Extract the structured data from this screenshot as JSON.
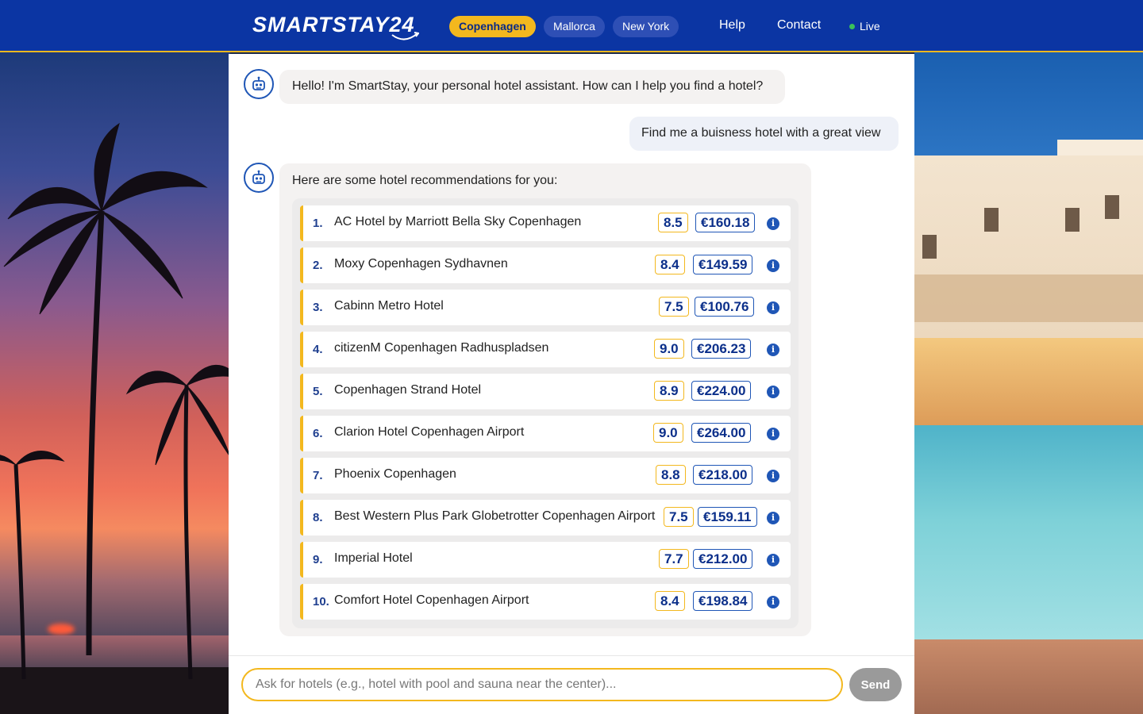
{
  "header": {
    "logo": "SMARTSTAY24",
    "cities": [
      "Copenhagen",
      "Mallorca",
      "New York"
    ],
    "active_city": "Copenhagen",
    "nav": {
      "help": "Help",
      "contact": "Contact"
    },
    "status": "Live"
  },
  "chat": {
    "greeting": "Hello! I'm SmartStay, your personal hotel assistant. How can I help you find a hotel?",
    "user_message": "Find me a buisness hotel with a great view",
    "reply_intro": "Here are some hotel recommendations for you:",
    "hotels": [
      {
        "num": "1.",
        "name": "AC Hotel by Marriott Bella Sky Copenhagen",
        "score": "8.5",
        "price": "€160.18"
      },
      {
        "num": "2.",
        "name": "Moxy Copenhagen Sydhavnen",
        "score": "8.4",
        "price": "€149.59"
      },
      {
        "num": "3.",
        "name": "Cabinn Metro Hotel",
        "score": "7.5",
        "price": "€100.76"
      },
      {
        "num": "4.",
        "name": "citizenM Copenhagen Radhuspladsen",
        "score": "9.0",
        "price": "€206.23"
      },
      {
        "num": "5.",
        "name": "Copenhagen Strand Hotel",
        "score": "8.9",
        "price": "€224.00"
      },
      {
        "num": "6.",
        "name": "Clarion Hotel Copenhagen Airport",
        "score": "9.0",
        "price": "€264.00"
      },
      {
        "num": "7.",
        "name": "Phoenix Copenhagen",
        "score": "8.8",
        "price": "€218.00"
      },
      {
        "num": "8.",
        "name": "Best Western Plus Park Globetrotter Copenhagen Airport",
        "score": "7.5",
        "price": "€159.11"
      },
      {
        "num": "9.",
        "name": "Imperial Hotel",
        "score": "7.7",
        "price": "€212.00"
      },
      {
        "num": "10.",
        "name": "Comfort Hotel Copenhagen Airport",
        "score": "8.4",
        "price": "€198.84"
      }
    ],
    "info_icon_glyph": "i"
  },
  "composer": {
    "placeholder": "Ask for hotels (e.g., hotel with pool and sauna near the center)...",
    "send_label": "Send"
  },
  "colors": {
    "brand_blue": "#0b35a3",
    "accent_yellow": "#f3b81e",
    "badge_text": "#0b2f8a"
  }
}
